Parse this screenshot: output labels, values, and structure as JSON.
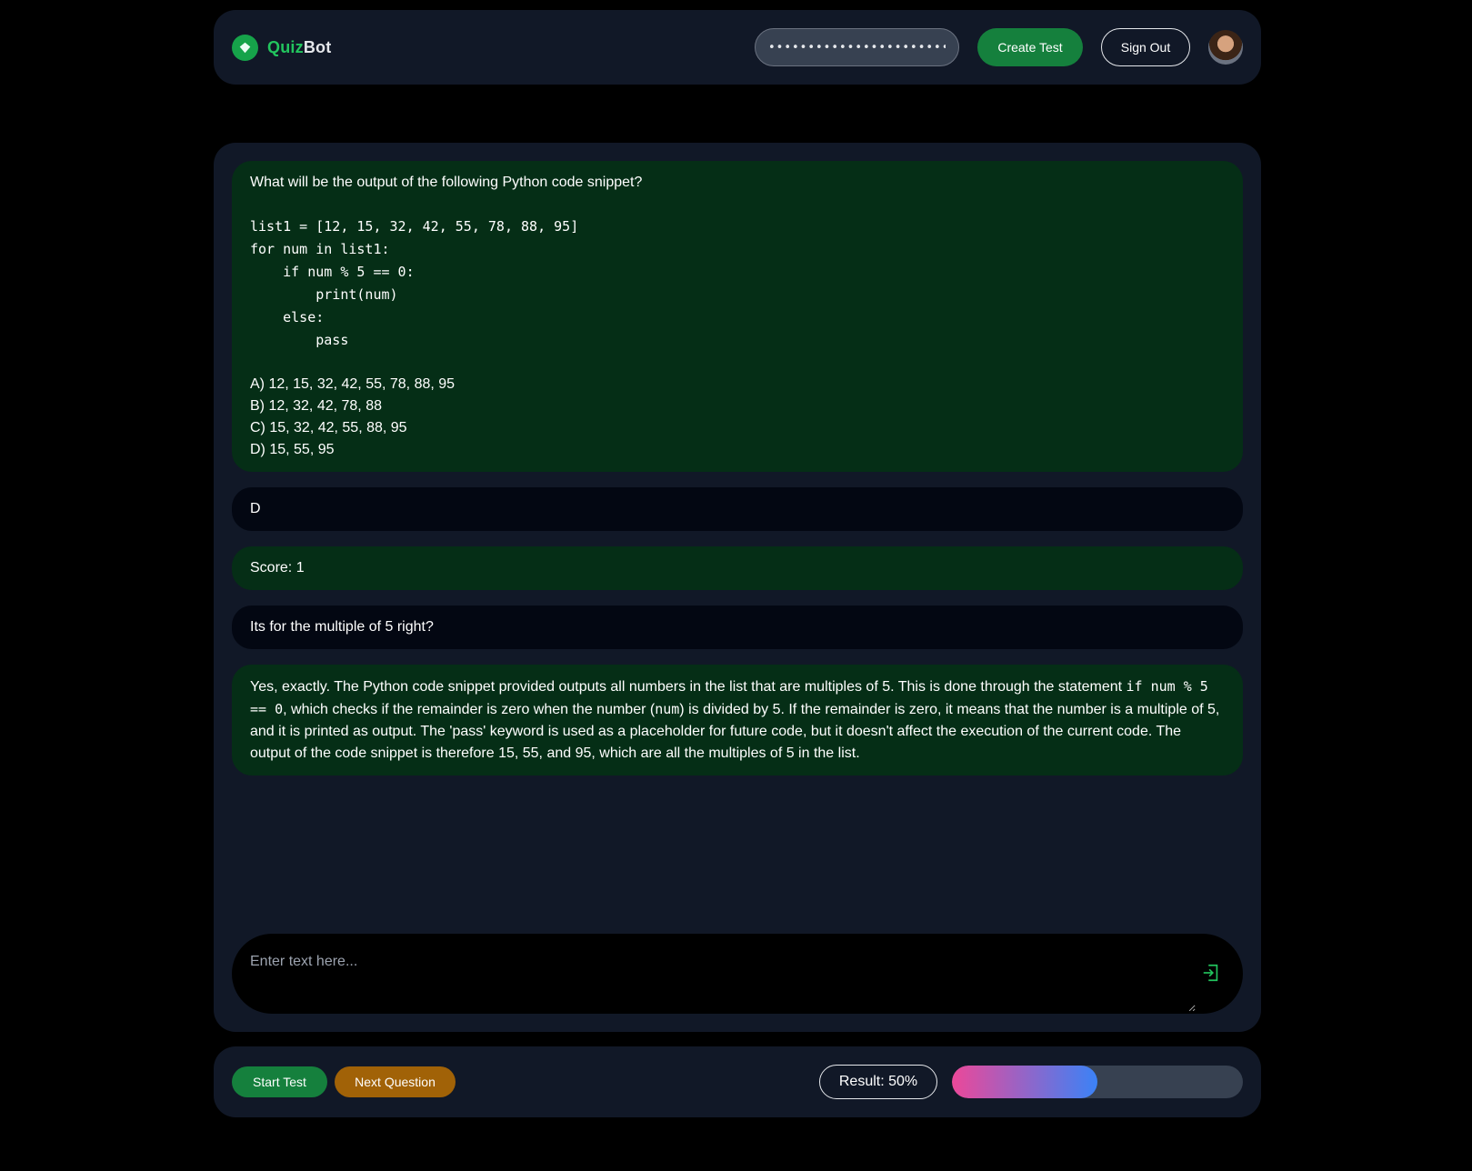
{
  "header": {
    "logo_part1": "Quiz",
    "logo_part2": "Bot",
    "api_key_value": "••••••••••••••••••••••••••••••••••",
    "create_test_label": "Create Test",
    "sign_out_label": "Sign Out"
  },
  "messages": [
    {
      "role": "bot",
      "intro": "What will be the output of the following Python code snippet?",
      "code": "list1 = [12, 15, 32, 42, 55, 78, 88, 95]\nfor num in list1:\n    if num % 5 == 0:\n        print(num)\n    else:\n        pass",
      "options": "A) 12, 15, 32, 42, 55, 78, 88, 95\nB) 12, 32, 42, 78, 88\nC) 15, 32, 42, 55, 88, 95\nD) 15, 55, 95"
    },
    {
      "role": "user",
      "text": "D"
    },
    {
      "role": "bot",
      "text": "Score: 1"
    },
    {
      "role": "user",
      "text": "Its for the multiple of 5 right?"
    },
    {
      "role": "bot",
      "text_a": "Yes, exactly. The Python code snippet provided outputs all numbers in the list that are multiples of 5. This is done through the statement ",
      "code_a": "if num % 5 == 0",
      "text_b": ", which checks if the remainder is zero when the number (",
      "code_b": "num",
      "text_c": ") is divided by 5. If the remainder is zero, it means that the number is a multiple of 5, and it is printed as output. The 'pass' keyword is used as a placeholder for future code, but it doesn't affect the execution of the current code. The output of the code snippet is therefore 15, 55, and 95, which are all the multiples of 5 in the list."
    }
  ],
  "input": {
    "placeholder": "Enter text here..."
  },
  "footer": {
    "start_test_label": "Start Test",
    "next_question_label": "Next Question",
    "result_label": "Result: 50%",
    "progress_fraction": 0.5
  },
  "icons": {
    "logo": "quizbot-logo-icon",
    "send": "send-icon",
    "avatar": "user-avatar"
  },
  "colors": {
    "accent_green": "#15803d",
    "accent_orange": "#a16207",
    "bot_bubble": "#052e16",
    "user_bubble": "#030712",
    "progress_start": "#ec4899",
    "progress_end": "#3b82f6"
  }
}
